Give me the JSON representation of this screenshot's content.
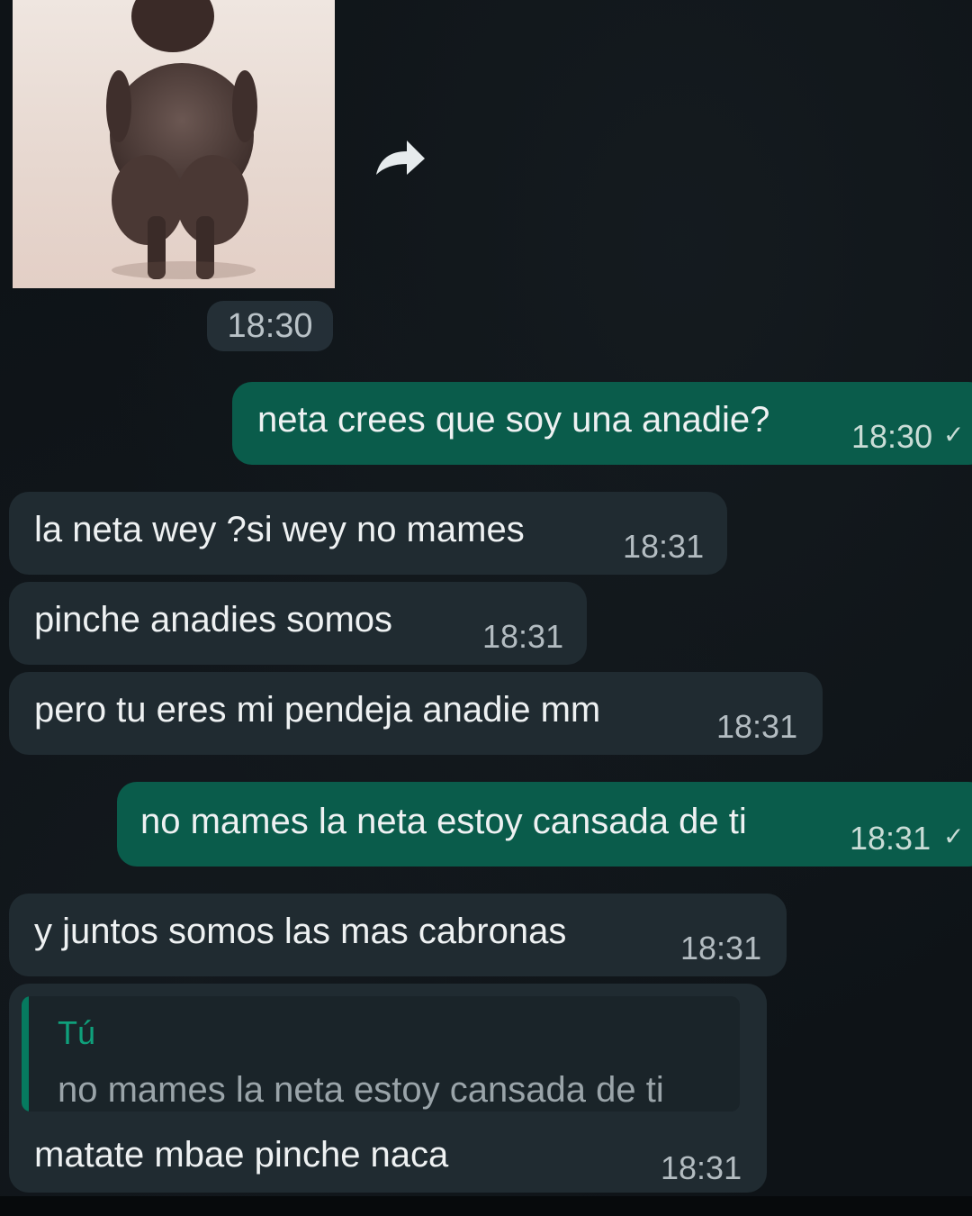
{
  "image_message": {
    "time": "18:30",
    "forward_icon": "forward-arrow-icon"
  },
  "messages": [
    {
      "id": "m1",
      "direction": "outgoing",
      "text": "neta crees que soy una anadie?",
      "time": "18:30",
      "status_icon": "check-icon"
    },
    {
      "id": "m2",
      "direction": "incoming",
      "text": "la neta wey ?si wey no mames",
      "time": "18:31"
    },
    {
      "id": "m3",
      "direction": "incoming",
      "text": "pinche anadies somos",
      "time": "18:31"
    },
    {
      "id": "m4",
      "direction": "incoming",
      "text": "pero tu eres mi pendeja anadie mm",
      "time": "18:31"
    },
    {
      "id": "m5",
      "direction": "outgoing",
      "text": "no mames la neta estoy cansada de ti",
      "time": "18:31",
      "status_icon": "check-icon"
    },
    {
      "id": "m6",
      "direction": "incoming",
      "text": "y juntos somos las mas cabronas",
      "time": "18:31"
    },
    {
      "id": "m7",
      "direction": "incoming",
      "text": "matate mbae pinche naca",
      "time": "18:31",
      "quote": {
        "author": "Tú",
        "text": "no mames la neta estoy cansada de ti"
      }
    }
  ],
  "colors": {
    "background": "#0e1317",
    "incoming_bubble": "#202b31",
    "outgoing_bubble": "#0a5c4b",
    "quote_accent": "#067a5f"
  }
}
